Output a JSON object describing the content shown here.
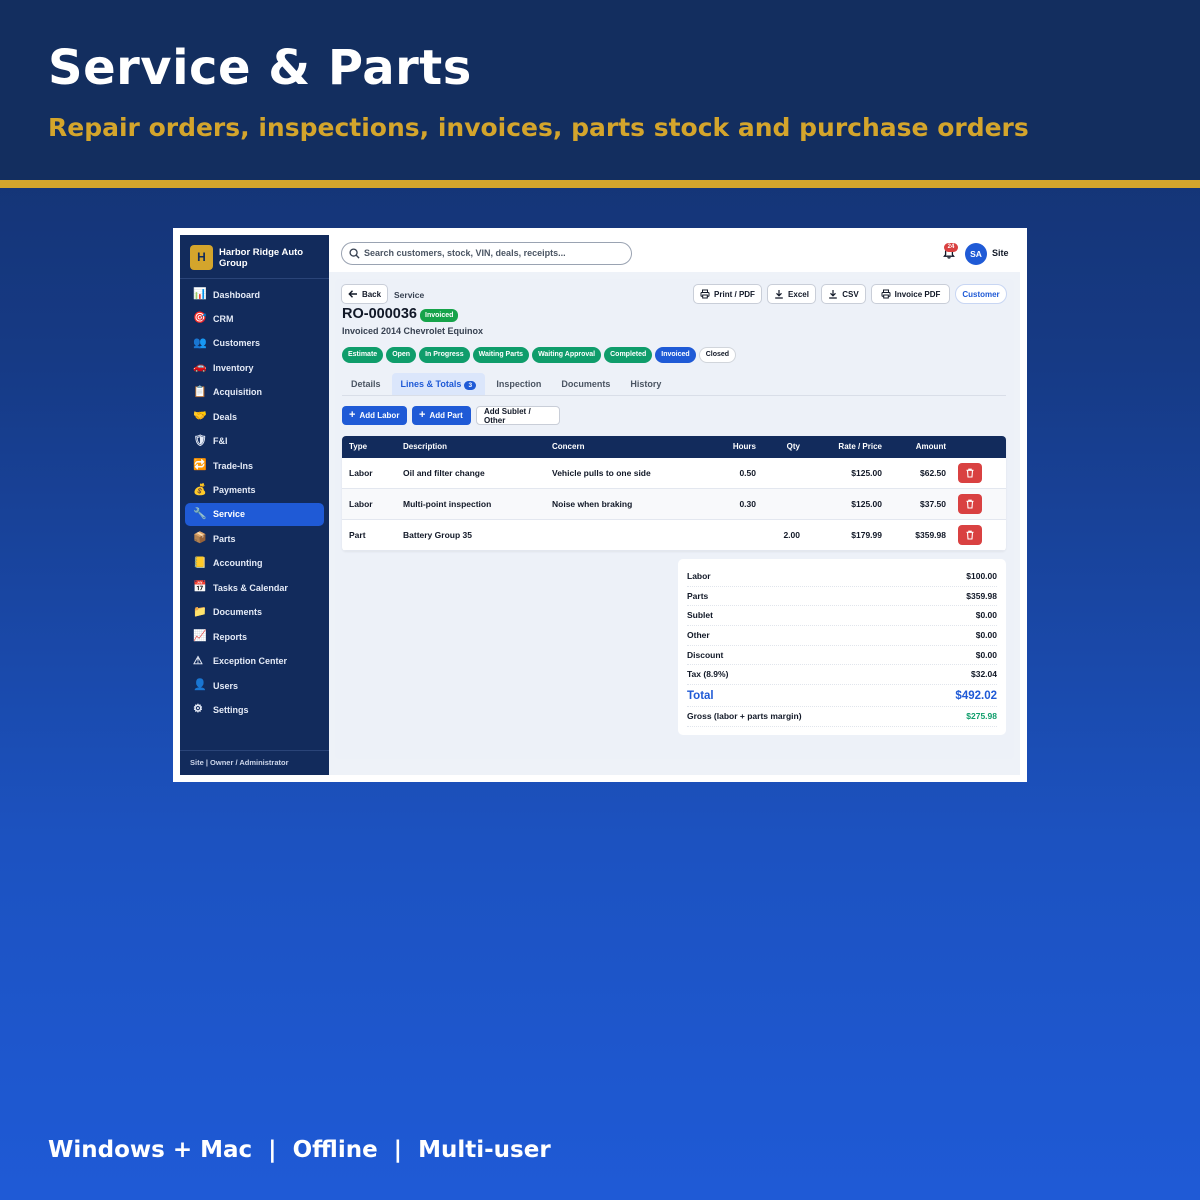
{
  "banner": {
    "title": "Service & Parts",
    "subtitle": "Repair orders, inspections, invoices, parts stock and purchase orders"
  },
  "footer": "Windows + Mac  |  Offline  |  Multi-user",
  "colors": {
    "navy": "#122b5c",
    "gold": "#d4a52c",
    "primary": "#1f5ad6",
    "success": "#0f9d6b",
    "danger": "#d94141"
  },
  "app": {
    "brand": {
      "logo_letter": "H",
      "name": "Harbor Ridge Auto Group"
    },
    "nav": [
      {
        "label": "Dashboard",
        "icon": "chart-icon"
      },
      {
        "label": "CRM",
        "icon": "target-icon"
      },
      {
        "label": "Customers",
        "icon": "people-icon"
      },
      {
        "label": "Inventory",
        "icon": "car-icon"
      },
      {
        "label": "Acquisition",
        "icon": "clipboard-icon"
      },
      {
        "label": "Deals",
        "icon": "handshake-icon"
      },
      {
        "label": "F&I",
        "icon": "shield-icon"
      },
      {
        "label": "Trade-Ins",
        "icon": "swap-icon"
      },
      {
        "label": "Payments",
        "icon": "money-bag-icon"
      },
      {
        "label": "Service",
        "icon": "wrench-icon",
        "active": true
      },
      {
        "label": "Parts",
        "icon": "package-icon"
      },
      {
        "label": "Accounting",
        "icon": "ledger-icon"
      },
      {
        "label": "Tasks & Calendar",
        "icon": "calendar-icon"
      },
      {
        "label": "Documents",
        "icon": "folder-icon"
      },
      {
        "label": "Reports",
        "icon": "trend-icon"
      },
      {
        "label": "Exception Center",
        "icon": "warning-icon"
      },
      {
        "label": "Users",
        "icon": "user-icon"
      },
      {
        "label": "Settings",
        "icon": "gear-icon"
      }
    ],
    "sidebar_footer": "Site | Owner / Administrator",
    "search": {
      "placeholder": "Search customers, stock, VIN, deals, receipts..."
    },
    "notifications": {
      "count": "24"
    },
    "user": {
      "initials": "SA",
      "label": "Site"
    },
    "toolbar": {
      "back": "Back",
      "crumb": "Service",
      "print": "Print / PDF",
      "excel": "Excel",
      "csv": "CSV",
      "invoice_pdf": "Invoice PDF",
      "customer": "Customer"
    },
    "repair_order": {
      "number": "RO-000036",
      "status": "Invoiced",
      "subtitle": "Invoiced 2014 Chevrolet Equinox"
    },
    "pipeline": [
      {
        "label": "Estimate",
        "state": "done"
      },
      {
        "label": "Open",
        "state": "done"
      },
      {
        "label": "In Progress",
        "state": "done"
      },
      {
        "label": "Waiting Parts",
        "state": "done"
      },
      {
        "label": "Waiting Approval",
        "state": "done"
      },
      {
        "label": "Completed",
        "state": "done"
      },
      {
        "label": "Invoiced",
        "state": "current"
      },
      {
        "label": "Closed",
        "state": "future"
      }
    ],
    "tabs": [
      {
        "label": "Details"
      },
      {
        "label": "Lines & Totals",
        "badge": "3",
        "active": true
      },
      {
        "label": "Inspection"
      },
      {
        "label": "Documents"
      },
      {
        "label": "History"
      }
    ],
    "actions": {
      "add_labor": "Add Labor",
      "add_part": "Add Part",
      "add_sublet": "Add Sublet / Other"
    },
    "lines": {
      "columns": [
        "Type",
        "Description",
        "Concern",
        "Hours",
        "Qty",
        "Rate / Price",
        "Amount"
      ],
      "rows": [
        {
          "type": "Labor",
          "description": "Oil and filter change",
          "concern": "Vehicle pulls to one side",
          "hours": "0.50",
          "qty": "",
          "rate": "$125.00",
          "amount": "$62.50"
        },
        {
          "type": "Labor",
          "description": "Multi-point inspection",
          "concern": "Noise when braking",
          "hours": "0.30",
          "qty": "",
          "rate": "$125.00",
          "amount": "$37.50"
        },
        {
          "type": "Part",
          "description": "Battery Group 35",
          "concern": "",
          "hours": "",
          "qty": "2.00",
          "rate": "$179.99",
          "amount": "$359.98"
        }
      ]
    },
    "totals": [
      {
        "label": "Labor",
        "value": "$100.00"
      },
      {
        "label": "Parts",
        "value": "$359.98"
      },
      {
        "label": "Sublet",
        "value": "$0.00"
      },
      {
        "label": "Other",
        "value": "$0.00"
      },
      {
        "label": "Discount",
        "value": "$0.00"
      },
      {
        "label": "Tax (8.9%)",
        "value": "$32.04"
      },
      {
        "label": "Total",
        "value": "$492.02",
        "kind": "total"
      },
      {
        "label": "Gross (labor + parts margin)",
        "value": "$275.98",
        "kind": "gross"
      }
    ]
  }
}
